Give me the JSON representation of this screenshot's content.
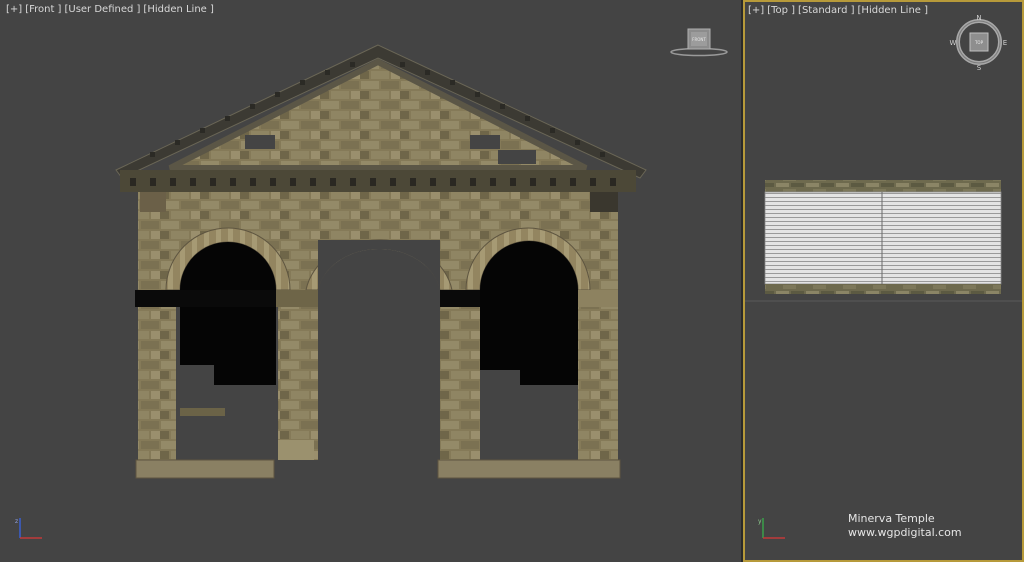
{
  "front_viewport": {
    "labels": [
      "[+]",
      "[Front ]",
      "[User Defined ]",
      "[Hidden Line ]"
    ],
    "viewcube_face": "FRONT"
  },
  "top_viewport": {
    "labels": [
      "[+]",
      "[Top ]",
      "[Standard ]",
      "[Hidden Line ]"
    ],
    "viewcube_face": "TOP",
    "compass": {
      "north": "N",
      "south": "S",
      "east": "E",
      "west": "W"
    }
  },
  "watermark": {
    "title": "Minerva Temple",
    "url": "www.wgpdigital.com"
  },
  "colors": {
    "viewport_bg": "#444444",
    "active_border": "#b79a3a",
    "stone": "#8a7f5f",
    "stone_dark": "#5e5540",
    "void": "#050505"
  },
  "icons": [
    "axis-gizmo-icon",
    "viewcube-icon",
    "compass-icon"
  ]
}
